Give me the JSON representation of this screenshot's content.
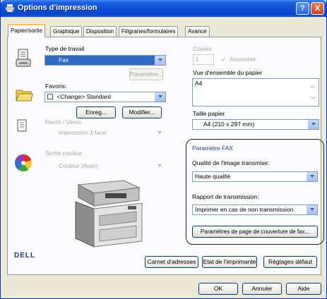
{
  "window": {
    "title": "Options d'impression",
    "help_label": "?",
    "close_label": "X"
  },
  "tabs": [
    "Papier/sortie",
    "Graphique",
    "Disposition",
    "Filigranes/formulaires",
    "Avancé"
  ],
  "left": {
    "job_type_label": "Type de travail",
    "job_type_value": "Fax",
    "parameter_label": "Paramètre...",
    "favorites_label": "Favoris:",
    "favorites_value": "<Change> Standard",
    "save_label": "Enreg...",
    "modify_label": "Modifier...",
    "duplex_label": "Recto / Verso",
    "duplex_value": "Impression 1 face",
    "color_label": "Sortie couleur",
    "color_value": "Couleur (Auto)"
  },
  "right": {
    "copies_label": "Copies",
    "copies_value": "1",
    "collate_label": "Assemblé",
    "overview_label": "Vue d'ensemble du papier",
    "overview_value": "A4",
    "paper_size_label": "Taille papier",
    "paper_size_value": "A4 (210 x 297 mm)"
  },
  "fax": {
    "title": "Paramètre FAX",
    "quality_label": "Qualité de l'image transmise:",
    "quality_value": "Haute qualité",
    "report_label": "Rapport de transmission:",
    "report_value": "Imprimer en cas de non transmission",
    "cover_button": "Paramètres de page de couverture de fax..."
  },
  "brand": "DELL",
  "bottom_buttons": {
    "address_book": "Carnet d'adresses",
    "printer_status": "Etat de l'imprimante",
    "defaults": "Réglages défaut"
  },
  "dialog_buttons": {
    "ok": "OK",
    "cancel": "Annuler",
    "help": "Aide"
  },
  "colors": {
    "title_blue": "#0a4fd6",
    "selection": "#316ac5",
    "fax_title": "#1f3f9a"
  }
}
